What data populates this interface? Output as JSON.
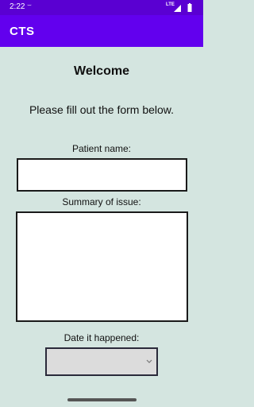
{
  "status_bar": {
    "time": "2:22",
    "misc_glyph": "⌣",
    "network": "LTE",
    "icons": [
      "signal-icon",
      "battery-icon"
    ]
  },
  "app_bar": {
    "title": "CTS"
  },
  "form": {
    "welcome": "Welcome",
    "intro": "Please fill out the form below.",
    "patient_name_label": "Patient name:",
    "patient_name_value": "",
    "summary_label": "Summary of issue:",
    "summary_value": "",
    "date_label": "Date it happened:",
    "date_value": ""
  },
  "colors": {
    "status_bar": "#5a00d2",
    "app_bar": "#6200ee",
    "background": "#d4e5e0"
  }
}
